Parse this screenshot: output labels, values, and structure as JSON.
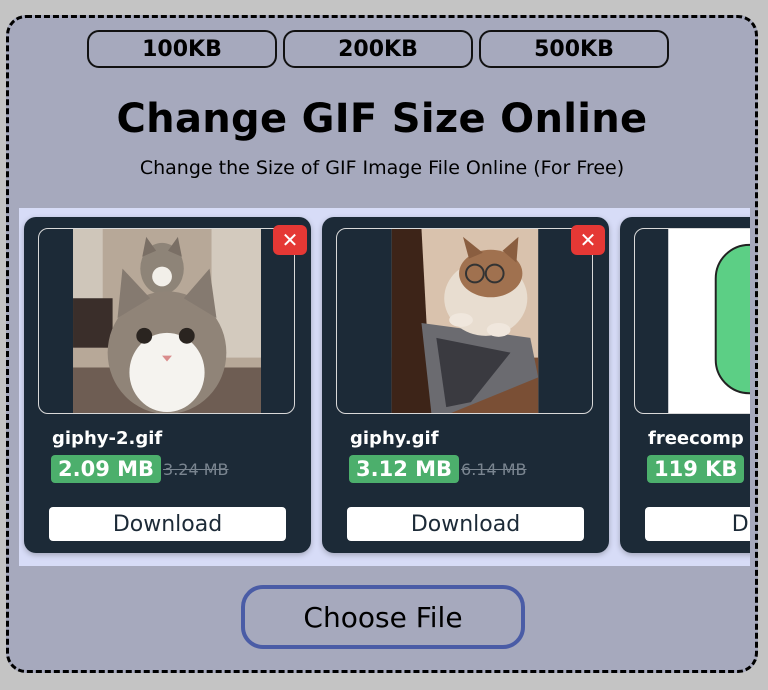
{
  "size_presets": [
    {
      "label": "100KB"
    },
    {
      "label": "200KB"
    },
    {
      "label": "500KB"
    }
  ],
  "header": {
    "title": "Change GIF Size Online",
    "subtitle": "Change the Size of GIF Image File Online (For Free)"
  },
  "files": [
    {
      "name": "giphy-2.gif",
      "new_size": "2.09 MB",
      "old_size": "3.24 MB",
      "download_label": "Download",
      "remove_label": "✕",
      "thumbnail": "cats-looking-at-camera",
      "thumb_colors": [
        "#8e7f6f",
        "#d8cfc4",
        "#f1ece6"
      ]
    },
    {
      "name": "giphy.gif",
      "new_size": "3.12 MB",
      "old_size": "6.14 MB",
      "download_label": "Download",
      "remove_label": "✕",
      "thumbnail": "cat-with-glasses-at-laptop",
      "thumb_colors": [
        "#4a2b1f",
        "#c9a88c",
        "#6e6e72"
      ]
    },
    {
      "name": "freecomp",
      "new_size": "119 KB",
      "old_size": "",
      "download_label": "Dov",
      "remove_label": "",
      "thumbnail": "green-rounded-shape",
      "thumb_colors": [
        "#ffffff",
        "#5ccf85",
        "#ffffff"
      ]
    }
  ],
  "actions": {
    "choose_file_label": "Choose File"
  },
  "colors": {
    "panel_bg": "#a6a9bd",
    "card_bg": "#1c2a37",
    "size_badge": "#4caf6c",
    "remove": "#e53835",
    "choose_border": "#4a5ca6"
  }
}
